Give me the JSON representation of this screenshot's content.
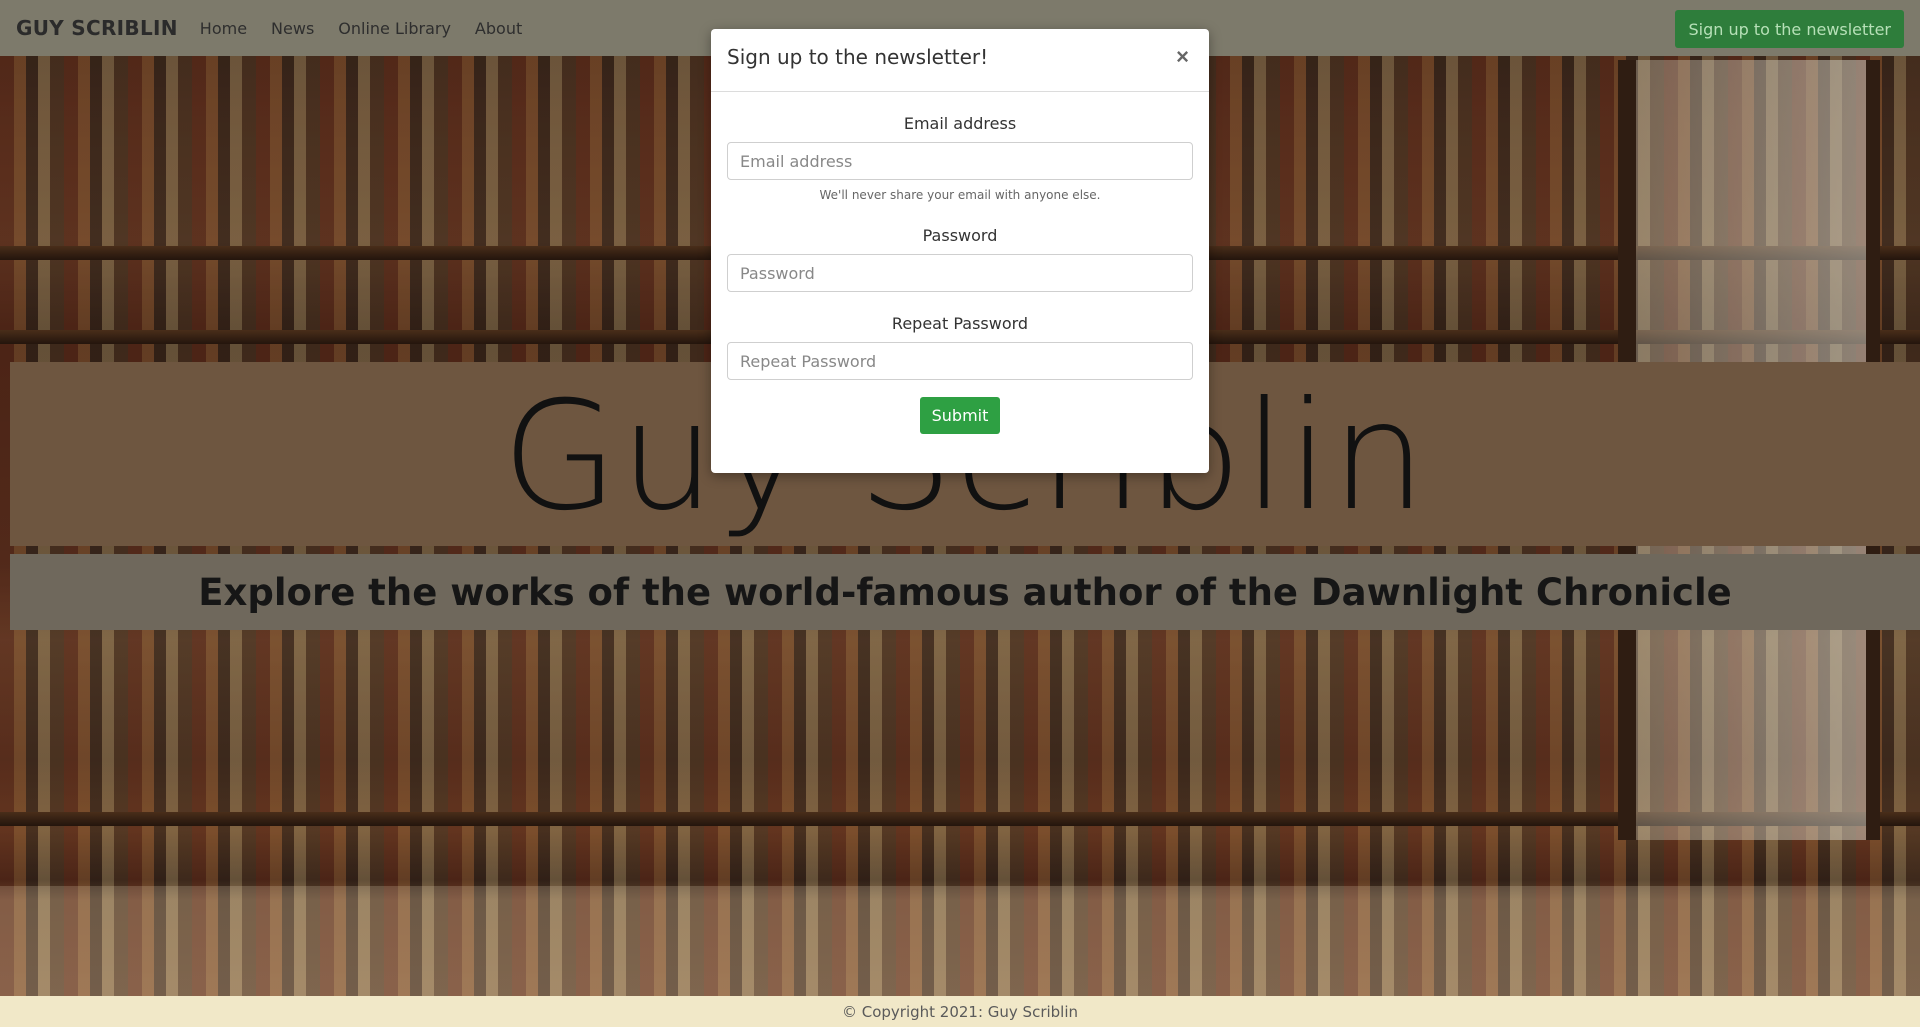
{
  "navbar": {
    "brand": "GUY SCRIBLIN",
    "links": [
      "Home",
      "News",
      "Online Library",
      "About"
    ],
    "cta_label": "Sign up to the newsletter"
  },
  "hero": {
    "title": "Guy Scriblin",
    "subtitle": "Explore the works of the world-famous author of the Dawnlight Chronicle"
  },
  "modal": {
    "title": "Sign up to the newsletter!",
    "close_symbol": "×",
    "email": {
      "label": "Email address",
      "placeholder": "Email address",
      "help": "We'll never share your email with anyone else."
    },
    "password": {
      "label": "Password",
      "placeholder": "Password"
    },
    "repeat_password": {
      "label": "Repeat Password",
      "placeholder": "Repeat Password"
    },
    "submit_label": "Submit"
  },
  "footer": {
    "copyright": "© Copyright 2021: Guy Scriblin"
  },
  "colors": {
    "navbar_bg": "#7d7a6b",
    "cta_bg": "#2e7d3b",
    "submit_bg": "#2ea043",
    "footer_bg": "#f1e8c8",
    "title_band_bg": "#6e5640",
    "subtitle_band_bg": "#6f685c"
  }
}
